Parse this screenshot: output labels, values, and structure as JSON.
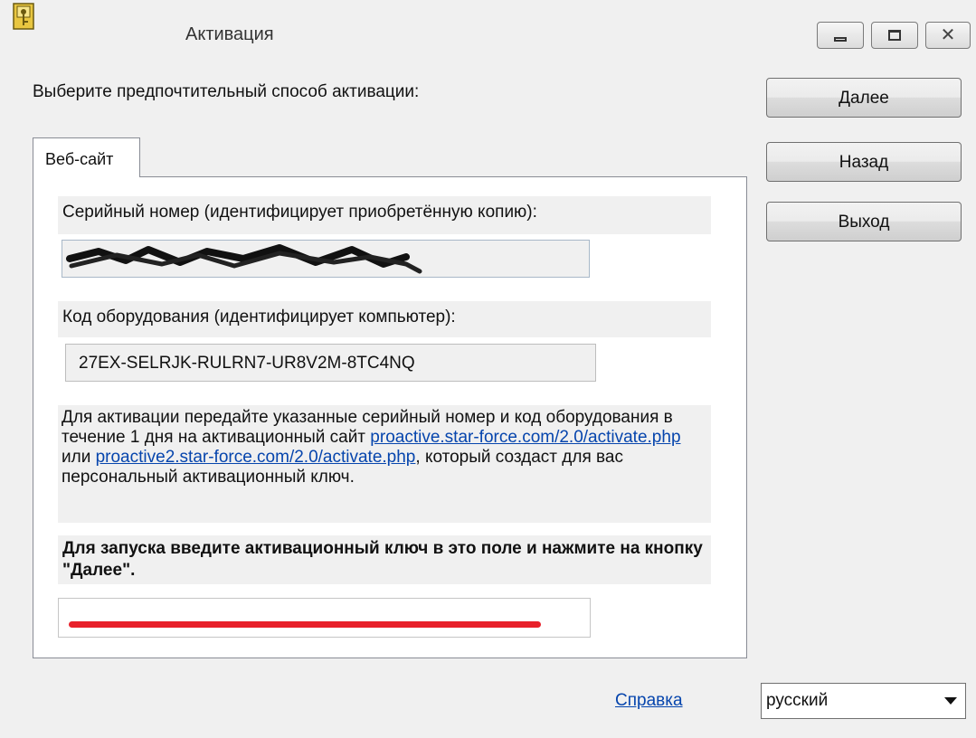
{
  "window": {
    "title": "Активация"
  },
  "prompt": "Выберите предпочтительный способ активации:",
  "buttons": {
    "next": "Далее",
    "back": "Назад",
    "exit": "Выход"
  },
  "tab": {
    "label": "Веб-сайт"
  },
  "serial": {
    "label": "Серийный номер (идентифицирует приобретённую копию):",
    "value_redacted": true
  },
  "hardware": {
    "label": "Код оборудования (идентифицирует компьютер):",
    "value": "27EX-SELRJK-RULRN7-UR8V2M-8TC4NQ"
  },
  "instructions": {
    "text_1": "Для активации передайте указанные серийный номер и код оборудования в течение 1 дня на активационный сайт ",
    "link_1": "proactive.star-force.com/2.0/activate.php",
    "text_2": " или ",
    "link_2": "proactive2.star-force.com/2.0/activate.php",
    "text_3": ", который создаст для вас персональный активационный ключ."
  },
  "key_prompt": "Для запуска введите активационный ключ в это поле и нажмите на кнопку \"Далее\".",
  "key_field": {
    "value_redacted": true,
    "redaction_color": "#e8202a"
  },
  "help_link": "Справка",
  "language": {
    "selected": "русский"
  }
}
